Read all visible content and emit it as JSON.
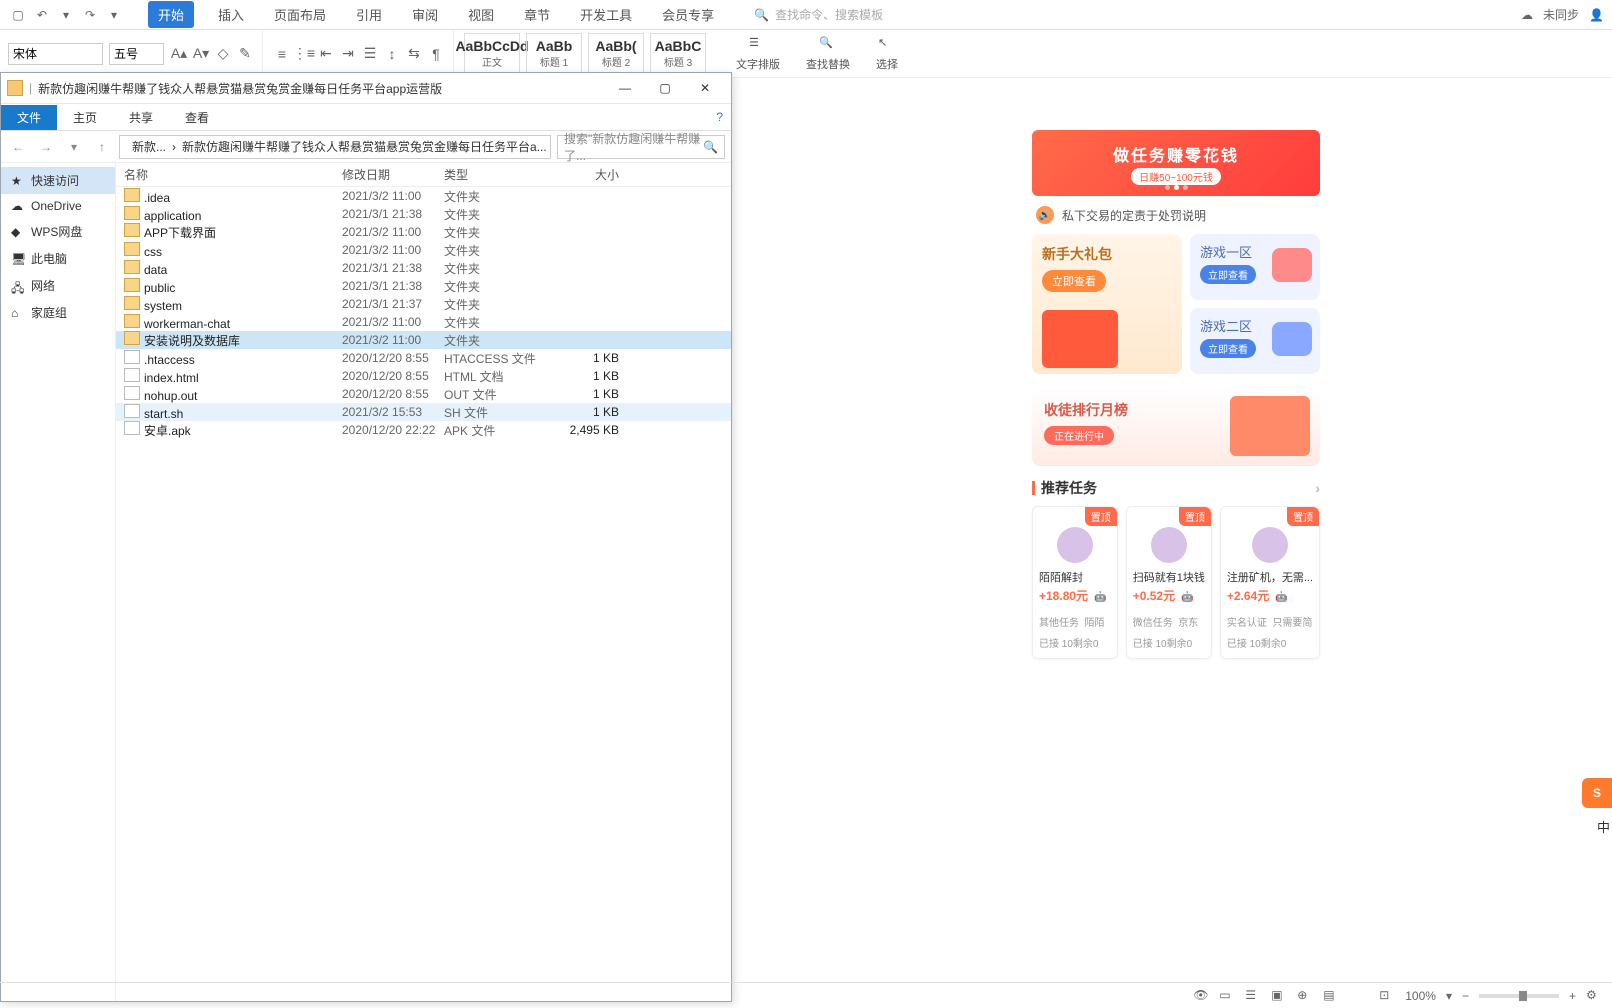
{
  "ribbon": {
    "tabs": [
      "开始",
      "插入",
      "页面布局",
      "引用",
      "审阅",
      "视图",
      "章节",
      "开发工具",
      "会员专享"
    ],
    "active_tab": "开始",
    "search_placeholder": "查找命令、搜索模板",
    "sync_label": "未同步",
    "font_name": "宋体",
    "font_size": "五号",
    "styles": [
      {
        "sample": "AaBbCcDd",
        "label": "正文"
      },
      {
        "sample": "AaBb",
        "label": "标题 1"
      },
      {
        "sample": "AaBb(",
        "label": "标题 2"
      },
      {
        "sample": "AaBbC",
        "label": "标题 3"
      }
    ],
    "side_buttons": [
      "文字排版",
      "查找替换",
      "选择"
    ]
  },
  "explorer": {
    "title": "新款仿趣闲赚牛帮赚了钱众人帮悬赏猫悬赏兔赏金赚每日任务平台app运营版",
    "tabs": [
      "文件",
      "主页",
      "共享",
      "查看"
    ],
    "breadcrumb": [
      "新款...",
      "新款仿趣闲赚牛帮赚了钱众人帮悬赏猫悬赏兔赏金赚每日任务平台a..."
    ],
    "search_placeholder": "搜索\"新款仿趣闲赚牛帮赚了...",
    "sidebar": [
      "快速访问",
      "OneDrive",
      "WPS网盘",
      "此电脑",
      "网络",
      "家庭组"
    ],
    "sidebar_active": "快速访问",
    "columns": [
      "名称",
      "修改日期",
      "类型",
      "大小"
    ],
    "files": [
      {
        "icon": "folder",
        "name": ".idea",
        "date": "2021/3/2 11:00",
        "type": "文件夹",
        "size": ""
      },
      {
        "icon": "folder",
        "name": "application",
        "date": "2021/3/1 21:38",
        "type": "文件夹",
        "size": ""
      },
      {
        "icon": "folder",
        "name": "APP下载界面",
        "date": "2021/3/2 11:00",
        "type": "文件夹",
        "size": ""
      },
      {
        "icon": "folder",
        "name": "css",
        "date": "2021/3/2 11:00",
        "type": "文件夹",
        "size": ""
      },
      {
        "icon": "folder",
        "name": "data",
        "date": "2021/3/1 21:38",
        "type": "文件夹",
        "size": ""
      },
      {
        "icon": "folder",
        "name": "public",
        "date": "2021/3/1 21:38",
        "type": "文件夹",
        "size": ""
      },
      {
        "icon": "folder",
        "name": "system",
        "date": "2021/3/1 21:37",
        "type": "文件夹",
        "size": ""
      },
      {
        "icon": "folder",
        "name": "workerman-chat",
        "date": "2021/3/2 11:00",
        "type": "文件夹",
        "size": ""
      },
      {
        "icon": "folder",
        "name": "安装说明及数据库",
        "date": "2021/3/2 11:00",
        "type": "文件夹",
        "size": "",
        "selected": true
      },
      {
        "icon": "file",
        "name": ".htaccess",
        "date": "2020/12/20 8:55",
        "type": "HTACCESS 文件",
        "size": "1 KB"
      },
      {
        "icon": "file",
        "name": "index.html",
        "date": "2020/12/20 8:55",
        "type": "HTML 文档",
        "size": "1 KB"
      },
      {
        "icon": "file",
        "name": "nohup.out",
        "date": "2020/12/20 8:55",
        "type": "OUT 文件",
        "size": "1 KB"
      },
      {
        "icon": "file",
        "name": "start.sh",
        "date": "2021/3/2 15:53",
        "type": "SH 文件",
        "size": "1 KB",
        "hover": true
      },
      {
        "icon": "file",
        "name": "安卓.apk",
        "date": "2020/12/20 22:22",
        "type": "APK 文件",
        "size": "2,495 KB"
      }
    ]
  },
  "phone": {
    "banner_title": "做任务赚零花钱",
    "banner_sub": "日赚50~100元钱",
    "notice": "私下交易的定责于处罚说明",
    "gift_title": "新手大礼包",
    "gift_btn": "立即查看",
    "zone1": {
      "title": "游戏一区",
      "btn": "立即查看"
    },
    "zone2": {
      "title": "游戏二区",
      "btn": "立即查看"
    },
    "rank_title": "收徒排行月榜",
    "rank_btn": "正在进行中",
    "section": "推荐任务",
    "tasks": [
      {
        "badge": "置顶",
        "title": "陌陌解封",
        "price": "+18.80元",
        "cat": "其他任务",
        "tag": "陌陌",
        "stat": "已接 10剩余0"
      },
      {
        "badge": "置顶",
        "title": "扫码就有1块钱",
        "price": "+0.52元",
        "cat": "微信任务",
        "tag": "京东",
        "stat": "已接 10剩余0"
      },
      {
        "badge": "置顶",
        "title": "注册矿机，无需...",
        "price": "+2.64元",
        "cat": "实名认证",
        "tag": "只需要简",
        "stat": "已接 10剩余0"
      }
    ]
  },
  "statusbar": {
    "zoom": "100%"
  },
  "sogou": {
    "letter": "S",
    "text": "中"
  }
}
